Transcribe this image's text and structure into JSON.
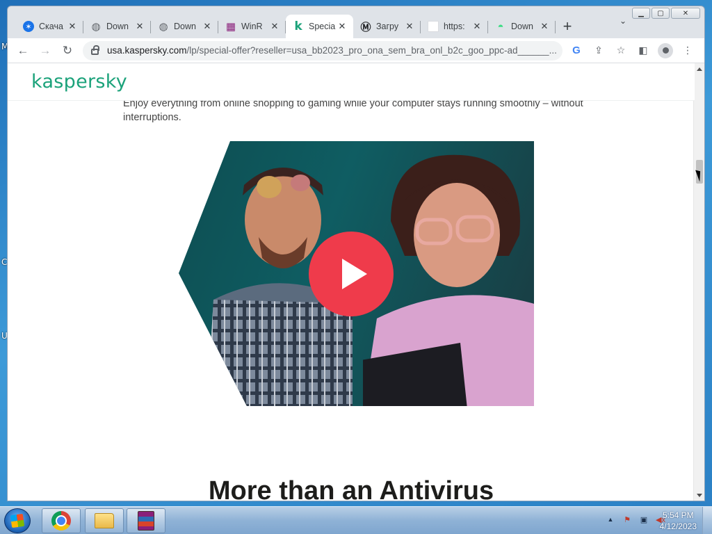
{
  "desktop": {
    "fragments": [
      "M",
      "C",
      "U"
    ]
  },
  "window": {
    "min": "▁",
    "max": "▢",
    "close": "✕"
  },
  "tabs": [
    {
      "title": "Скача",
      "favicon": "accessibility-icon",
      "glyph": "✶",
      "color": "#1a73e8"
    },
    {
      "title": "Down",
      "favicon": "globe-icon",
      "glyph": "◍",
      "color": "#5f6368"
    },
    {
      "title": "Down",
      "favicon": "globe-icon",
      "glyph": "◍",
      "color": "#5f6368"
    },
    {
      "title": "WinR",
      "favicon": "winrar-icon",
      "glyph": "▦",
      "color": "#8a1f7a"
    },
    {
      "title": "Specia",
      "favicon": "kaspersky-icon",
      "glyph": "k",
      "color": "#1ba27a",
      "active": true
    },
    {
      "title": "Загру",
      "favicon": "m-icon",
      "glyph": "Ⓜ",
      "color": "#202124"
    },
    {
      "title": "https:",
      "favicon": "blank-page-icon",
      "glyph": "",
      "color": "#ffffff"
    },
    {
      "title": "Down",
      "favicon": "android-icon",
      "glyph": "◓",
      "color": "#3ddc84"
    }
  ],
  "newtab": "+",
  "tab_search": "⌄",
  "toolbar": {
    "back": "←",
    "forward": "→",
    "reload": "↻",
    "url_host": "usa.kaspersky.com",
    "url_path": "/lp/special-offer?reseller=usa_bb2023_pro_ona_sem_bra_onl_b2c_goo_ppc-ad______...",
    "icons": {
      "google": "G",
      "share": "⇪",
      "bookmark": "☆",
      "sidepanel": "◧",
      "menu": "⋮"
    }
  },
  "page": {
    "logo": "kaspersky",
    "intro": "Enjoy everything from online shopping to gaming while your computer stays running smoothly – without interruptions.",
    "heading": "More than an Antivirus"
  },
  "taskbar": {
    "clock_time": "5:54 PM",
    "clock_date": "4/12/2023",
    "tray": {
      "chevron": "▲",
      "flag": "⚑",
      "network": "▣",
      "volume": "◀x"
    }
  }
}
